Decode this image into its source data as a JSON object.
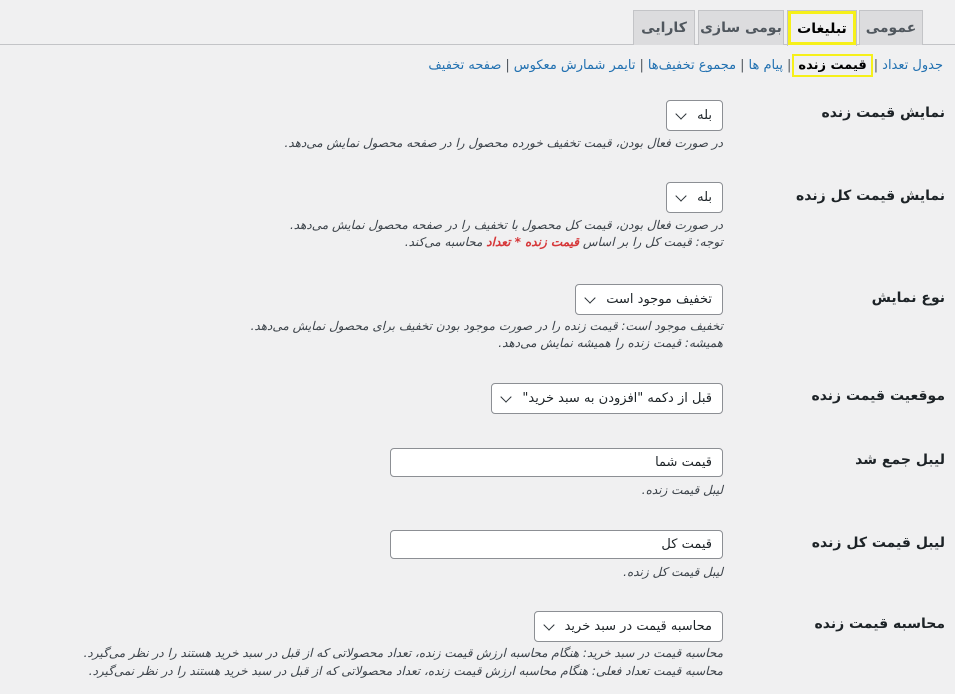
{
  "tabs": [
    {
      "label": "عمومی"
    },
    {
      "label": "تبلیغات"
    },
    {
      "label": "بومی سازی"
    },
    {
      "label": "کارایی"
    }
  ],
  "subnav": {
    "items": [
      "جدول تعداد",
      "قیمت زنده",
      "پیام ها",
      "مجموع تخفیف‌ها",
      "تایمر شمارش معکوس",
      "صفحه تخفیف"
    ],
    "separator": "|"
  },
  "fields": {
    "show_live_price": {
      "label": "نمایش قیمت زنده",
      "value": "بله",
      "desc": "در صورت فعال بودن، قیمت تخفیف خورده محصول را در صفحه محصول نمایش می‌دهد."
    },
    "show_live_total": {
      "label": "نمایش قیمت کل زنده",
      "value": "بله",
      "desc1": "در صورت فعال بودن، قیمت کل محصول با تخفیف را در صفحه محصول نمایش می‌دهد.",
      "desc2_a": "توجه: قیمت کل را بر اساس",
      "desc2_b": "قیمت زنده * تعداد",
      "desc2_c": "محاسبه می‌کند."
    },
    "display_type": {
      "label": "نوع نمایش",
      "value": "تخفیف موجود است",
      "desc1": "تخفیف موجود است: قیمت زنده را در صورت موجود بودن تخفیف برای محصول نمایش می‌دهد.",
      "desc2": "همیشه: قیمت زنده را همیشه نمایش می‌دهد."
    },
    "position": {
      "label": "موقعیت قیمت زنده",
      "value": "قبل از دکمه \"افزودن به سبد خرید\""
    },
    "subtotal_label": {
      "label": "لیبل جمع شد",
      "value": "قیمت شما",
      "desc": "لیبل قیمت زنده."
    },
    "total_label": {
      "label": "لیبل قیمت کل زنده",
      "value": "قیمت کل",
      "desc": "لیبل قیمت کل زنده."
    },
    "calc": {
      "label": "محاسبه قیمت زنده",
      "value": "محاسبه قیمت در سبد خرید",
      "desc1": "محاسبه قیمت در سبد خرید: هنگام محاسبه ارزش قیمت زنده، تعداد محصولاتی که از قبل در سبد خرید هستند را در نظر می‌گیرد.",
      "desc2": "محاسبه قیمت تعداد فعلی: هنگام محاسبه ارزش قیمت زنده، تعداد محصولاتی که از قبل در سبد خرید هستند را در نظر نمی‌گیرد."
    }
  },
  "icons": {
    "dropdown": "chevron-down-icon"
  },
  "colors": {
    "link": "#2271b1",
    "highlight": "#f6f01a",
    "emphasis": "#d63638"
  }
}
